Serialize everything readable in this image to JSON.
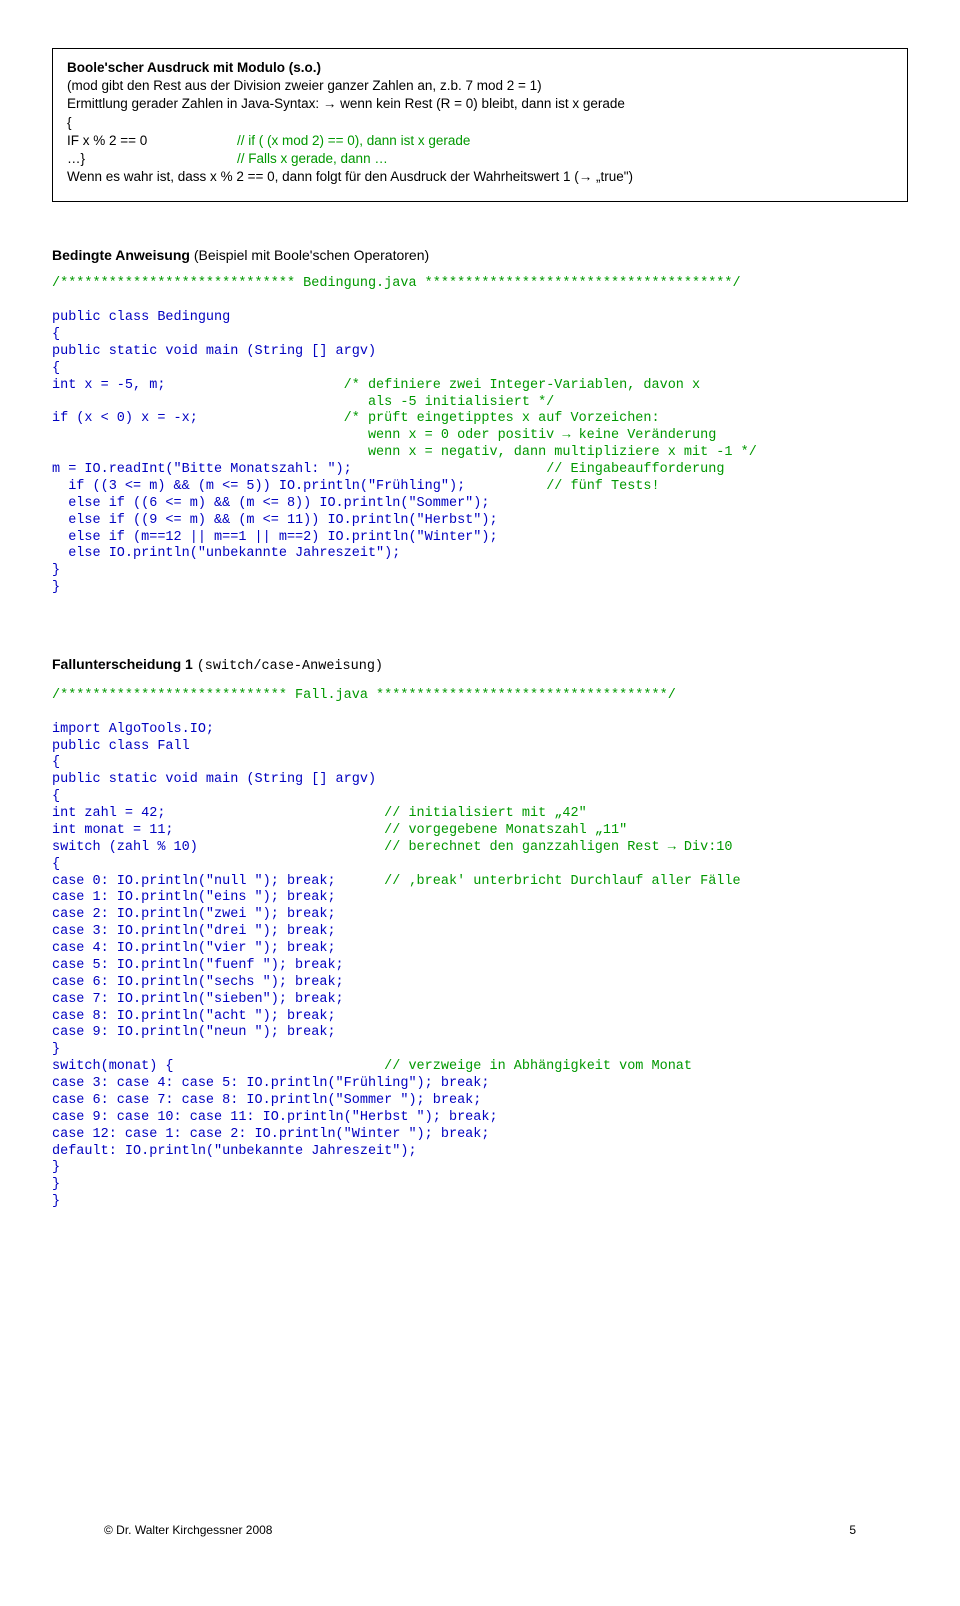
{
  "box": {
    "title": "Boole'scher Ausdruck mit Modulo (s.o.)",
    "line1": "(mod gibt den Rest aus der Division zweier ganzer Zahlen an, z.b. 7 mod 2 = 1)",
    "line2": "Ermittlung gerader Zahlen in Java-Syntax: → wenn kein Rest (R = 0) bleibt, dann ist x gerade",
    "brace_open": "{",
    "row1_left": "IF x % 2 == 0",
    "row1_right": "// if ( (x mod 2) == 0), dann ist x gerade",
    "row2_left": "…}",
    "row2_right": "// Falls x gerade, dann …",
    "line3": "Wenn es wahr ist, dass x % 2 == 0, dann folgt für den Ausdruck der Wahrheitswert 1 (→ „true\")"
  },
  "bedingte": {
    "title": "Bedingte Anweisung",
    "title_paren": " (Beispiel mit Boole'schen Operatoren)",
    "code": "/***************************** Bedingung.java **************************************/\n\npublic class Bedingung\n{\npublic static void main (String [] argv)\n{\nint x = -5, m;                      /* definiere zwei Integer-Variablen, davon x\n                                       als -5 initialisiert */\nif (x < 0) x = -x;                  /* prüft eingetipptes x auf Vorzeichen:\n                                       wenn x = 0 oder positiv → keine Veränderung\n                                       wenn x = negativ, dann multipliziere x mit -1 */\nm = IO.readInt(\"Bitte Monatszahl: \");                        // Eingabeaufforderung\n  if ((3 <= m) && (m <= 5)) IO.println(\"Frühling\");          // fünf Tests!\n  else if ((6 <= m) && (m <= 8)) IO.println(\"Sommer\");\n  else if ((9 <= m) && (m <= 11)) IO.println(\"Herbst\");\n  else if (m==12 || m==1 || m==2) IO.println(\"Winter\");\n  else IO.println(\"unbekannte Jahreszeit\");\n}\n}"
  },
  "fall": {
    "title": "Fallunterscheidung 1 ",
    "title_mono": "(switch/case-Anweisung)",
    "code": "/**************************** Fall.java ************************************/\n\nimport AlgoTools.IO;\npublic class Fall\n{\npublic static void main (String [] argv)\n{\nint zahl = 42;                           // initialisiert mit „42\"\nint monat = 11;                          // vorgegebene Monatszahl „11\"\nswitch (zahl % 10)                       // berechnet den ganzzahligen Rest → Div:10\n{\ncase 0: IO.println(\"null \"); break;      // ‚break' unterbricht Durchlauf aller Fälle\ncase 1: IO.println(\"eins \"); break;\ncase 2: IO.println(\"zwei \"); break;\ncase 3: IO.println(\"drei \"); break;\ncase 4: IO.println(\"vier \"); break;\ncase 5: IO.println(\"fuenf \"); break;\ncase 6: IO.println(\"sechs \"); break;\ncase 7: IO.println(\"sieben\"); break;\ncase 8: IO.println(\"acht \"); break;\ncase 9: IO.println(\"neun \"); break;\n}\nswitch(monat) {                          // verzweige in Abhängigkeit vom Monat\ncase 3: case 4: case 5: IO.println(\"Frühling\"); break;\ncase 6: case 7: case 8: IO.println(\"Sommer \"); break;\ncase 9: case 10: case 11: IO.println(\"Herbst \"); break;\ncase 12: case 1: case 2: IO.println(\"Winter \"); break;\ndefault: IO.println(\"unbekannte Jahreszeit\");\n}\n}\n}"
  },
  "footer": {
    "left": "© Dr. Walter Kirchgessner 2008",
    "right": "5"
  }
}
